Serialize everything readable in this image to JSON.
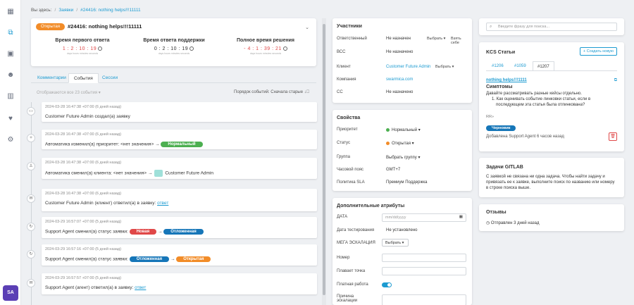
{
  "breadcrumb": {
    "prefix": "Вы здесь:",
    "sep": "/",
    "parent": "Заявки",
    "current": "#24416: nothing helps!!!11111"
  },
  "user": {
    "initials": "SA"
  },
  "ticket": {
    "status": "Открытая",
    "title": "#24416: nothing helps!!!11111",
    "collapse": "⌄",
    "sla": [
      {
        "title": "Время первого ответа",
        "value": "1 : 2 : 10 : 19",
        "units": "days  hours  minutes  seconds",
        "color": "#e04848"
      },
      {
        "title": "Время ответа поддержки",
        "value": "0 : 2 : 10 : 19",
        "units": "days  hours  minutes  seconds",
        "color": "#333333"
      },
      {
        "title": "Полное время решения",
        "value": "- 4 : 1 : 39 : 21",
        "units": "days  hours  minutes  seconds",
        "color": "#e04848"
      }
    ]
  },
  "tabs": {
    "comments": "Комментарии",
    "events": "События",
    "sessions": "Сессии"
  },
  "events_filter": {
    "shown": "Отображаются все 23 события ▾",
    "order": "Порядок событий: Сначала старые ↓⃝"
  },
  "events": [
    {
      "ts": "2024-03-28 16:47:38 +07:00 (6 дней назад)",
      "text": "Customer Future Admin  создал(а) заявку"
    },
    {
      "ts": "2024-03-28 16:47:38 +07:00 (6 дней назад)",
      "text": "Автоматика  изменил(а) приоритет:  <нет значения>  →",
      "pill": "Нормальный"
    },
    {
      "ts": "2024-03-28 16:47:38 +07:00 (6 дней назад)",
      "text": "Автоматика  сменил(а) клиента:  <нет значения>  →",
      "after": "Customer Future Admin"
    },
    {
      "ts": "2024-03-28 16:47:38 +07:00 (6 дней назад)",
      "text": "Customer Future Admin  (клиент) ответил(а) в заявку:",
      "link": "ответ"
    },
    {
      "ts": "2024-03-29 16:57:07 +07:00 (5 дней назад)",
      "text": "Support Agent  сменил(а) статус заявки:",
      "from": "Новая",
      "to": "Отложенная"
    },
    {
      "ts": "2024-03-29 16:57:16 +07:00 (5 дней назад)",
      "text": "Support Agent  сменил(а) статус заявки:",
      "from": "Отложенная",
      "to": "Открытая"
    },
    {
      "ts": "2024-03-29 16:57:57 +07:00 (5 дней назад)",
      "text": "Support Agent  (агент) ответил(а) в заявку:",
      "link": "ответ"
    }
  ],
  "arrow": "→",
  "participants": {
    "title": "Участники",
    "responsible_label": "Ответственный",
    "responsible_value": "Не назначен",
    "responsible_select": "Выбрать ▾",
    "responsible_self": "Взять себе",
    "bcc_label": "ВСС",
    "bcc_value": "Не назначено",
    "client_label": "Клиент",
    "client_value": "Customer Future Admin",
    "client_select": "Выбрать ▾",
    "company_label": "Компания",
    "company_value": "swarmica.com",
    "cc_label": "CC",
    "cc_value": "Не назначено"
  },
  "properties": {
    "title": "Свойства",
    "priority_label": "Приоритет",
    "priority_value": "Нормальный ▾",
    "priority_color": "#4caf50",
    "status_label": "Статус",
    "status_value": "Открытая ▾",
    "status_color": "#f28c28",
    "group_label": "Группа",
    "group_value": "Выбрать группу ▾",
    "tz_label": "Часовой пояс",
    "tz_value": "GMT+7",
    "sla_label": "Политика SLA",
    "sla_value": "Премиум Поддержка"
  },
  "extra": {
    "title": "Дополнительные атрибуты",
    "date_label": "ДАТА",
    "date_placeholder": "mm/dd/yyyy",
    "testdate_label": "Дата тестирования",
    "testdate_value": "Не установлено",
    "mega_label": "МЕГА ЭСКАЛАЦИЯ",
    "mega_value": "Выбрать ▾",
    "number_label": "Номер",
    "float_label": "Плавает точка",
    "paid_label": "Платная работа",
    "reason_label": "Причина эскалации"
  },
  "kb": {
    "search_placeholder": "Введите фразу для поиска...",
    "title": "KCS Статьи",
    "create": "+ Создать новую",
    "tabs": [
      "#1206",
      "#1059",
      "#1207"
    ],
    "article_link": "nothing helps!!!1111",
    "article_heading": "Симптомы",
    "body1": "Давайте рассматривать разные кейсы отдельно.",
    "body2": "1. Как оценивать событие линковки статьи, если в",
    "body3": "последующем эта статья была отлинкована?",
    "body4": "RR»",
    "draft": "Черновик",
    "added": "Добавлена Support Agent 6 часов назад"
  },
  "gitlab": {
    "title": "Задачи GITLAB",
    "text1": "С заявкой не связана ни одна задача. Чтобы найти задачу и",
    "text2": "привязать ее к заявке, выполните поиск по названию или номеру",
    "text3": "в строке поиска выше."
  },
  "feedback": {
    "title": "Отзывы",
    "text": "Отправлен 3 дней назад"
  }
}
